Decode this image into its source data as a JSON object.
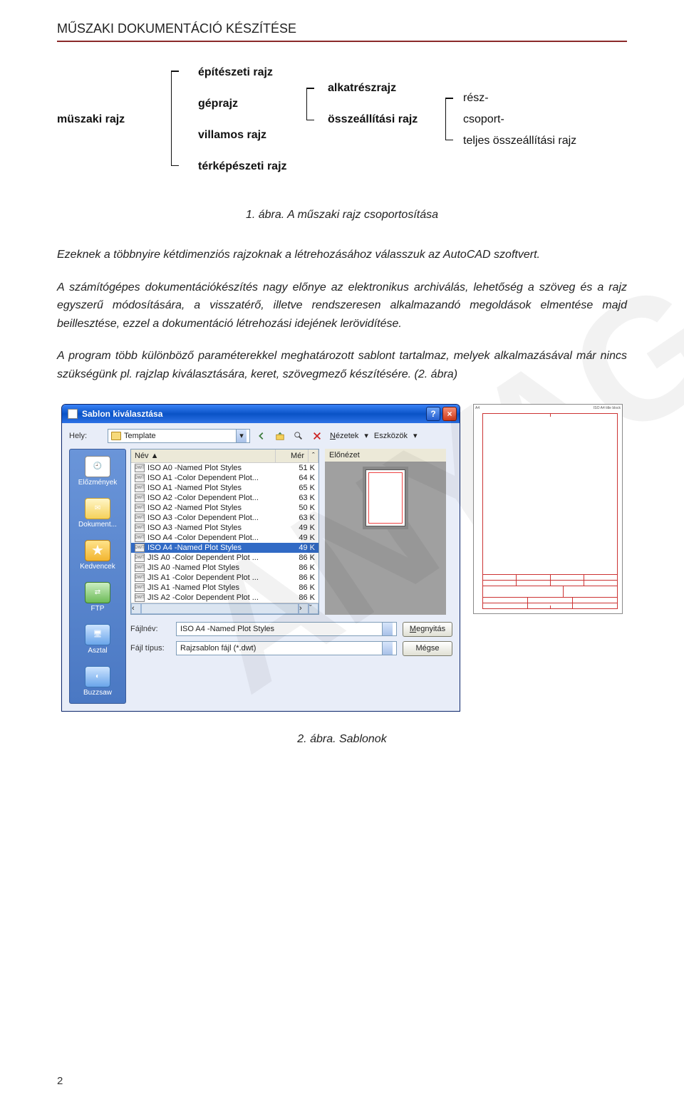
{
  "doc_header": "MŰSZAKI DOKUMENTÁCIÓ KÉSZÍTÉSE",
  "page_number": "2",
  "watermark": "ANYAG",
  "diagram": {
    "root": "müszaki rajz",
    "level1": {
      "epiteszeti": "építészeti rajz",
      "geprajz": "géprajz",
      "villamos": "villamos rajz",
      "terkep": "térképészeti rajz"
    },
    "level2": {
      "alkatresz": "alkatrészrajz",
      "osszeallitasi": "összeállítási rajz"
    },
    "level3": {
      "resz": "rész-",
      "csoport": "csoport-",
      "teljes": "teljes összeállítási rajz"
    }
  },
  "caption1": "1. ábra. A műszaki rajz csoportosítása",
  "paragraphs": {
    "p1": "Ezeknek a többnyire kétdimenziós rajzoknak a létrehozásához válasszuk az AutoCAD szoftvert.",
    "p2": "A számítógépes dokumentációkészítés nagy előnye az elektronikus archiválás, lehetőség a szöveg és a rajz egyszerű módosítására, a visszatérő, illetve rendszeresen alkalmazandó megoldások elmentése majd beillesztése, ezzel a dokumentáció létrehozási idejének lerövidítése.",
    "p3": "A program több különböző paraméterekkel meghatározott sablont tartalmaz, melyek alkalmazásával már nincs szükségünk pl. rajzlap kiválasztására, keret, szövegmező készítésére. (2. ábra)"
  },
  "dialog": {
    "title": "Sablon kiválasztása",
    "help_btn": "?",
    "close_btn": "×",
    "toolbar": {
      "hely_label": "Hely:",
      "folder": "Template",
      "nezetek": "Nézetek",
      "eszkozok": "Eszközök"
    },
    "list": {
      "col_name": "Név",
      "col_size": "Mér",
      "rows": [
        {
          "name": "ISO A0 -Named Plot Styles",
          "size": "51 K"
        },
        {
          "name": "ISO A1 -Color Dependent Plot...",
          "size": "64 K"
        },
        {
          "name": "ISO A1 -Named Plot Styles",
          "size": "65 K"
        },
        {
          "name": "ISO A2 -Color Dependent Plot...",
          "size": "63 K"
        },
        {
          "name": "ISO A2 -Named Plot Styles",
          "size": "50 K"
        },
        {
          "name": "ISO A3 -Color Dependent Plot...",
          "size": "63 K"
        },
        {
          "name": "ISO A3 -Named Plot Styles",
          "size": "49 K"
        },
        {
          "name": "ISO A4 -Color Dependent Plot...",
          "size": "49 K"
        },
        {
          "name": "ISO A4 -Named Plot Styles",
          "size": "49 K",
          "selected": true
        },
        {
          "name": "JIS A0 -Color Dependent Plot ...",
          "size": "86 K"
        },
        {
          "name": "JIS A0 -Named Plot Styles",
          "size": "86 K"
        },
        {
          "name": "JIS A1 -Color Dependent Plot ...",
          "size": "86 K"
        },
        {
          "name": "JIS A1 -Named Plot Styles",
          "size": "86 K"
        },
        {
          "name": "JIS A2 -Color Dependent Plot ...",
          "size": "86 K"
        }
      ]
    },
    "preview_label": "Előnézet",
    "places": {
      "elozmenyek": "Előzmények",
      "dokumentumok": "Dokument...",
      "kedvencek": "Kedvencek",
      "ftp": "FTP",
      "asztal": "Asztal",
      "buzzsaw": "Buzzsaw"
    },
    "bottom": {
      "fajlnev_label": "Fájlnév:",
      "fajlnev_value": "ISO A4 -Named Plot Styles",
      "fajltipus_label": "Fájl típus:",
      "fajltipus_value": "Rajzsablon fájl (*.dwt)",
      "open": "Megnyitás",
      "cancel": "Mégse"
    }
  },
  "caption2": "2. ábra. Sablonok"
}
